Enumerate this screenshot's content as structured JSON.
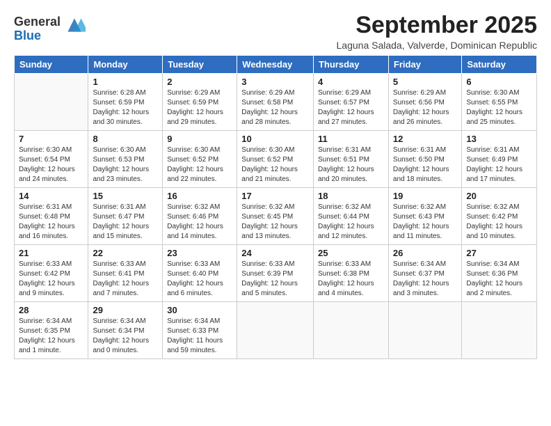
{
  "logo": {
    "general": "General",
    "blue": "Blue"
  },
  "title": "September 2025",
  "subtitle": "Laguna Salada, Valverde, Dominican Republic",
  "days": [
    "Sunday",
    "Monday",
    "Tuesday",
    "Wednesday",
    "Thursday",
    "Friday",
    "Saturday"
  ],
  "weeks": [
    [
      {
        "day": "",
        "content": ""
      },
      {
        "day": "1",
        "content": "Sunrise: 6:28 AM\nSunset: 6:59 PM\nDaylight: 12 hours\nand 30 minutes."
      },
      {
        "day": "2",
        "content": "Sunrise: 6:29 AM\nSunset: 6:59 PM\nDaylight: 12 hours\nand 29 minutes."
      },
      {
        "day": "3",
        "content": "Sunrise: 6:29 AM\nSunset: 6:58 PM\nDaylight: 12 hours\nand 28 minutes."
      },
      {
        "day": "4",
        "content": "Sunrise: 6:29 AM\nSunset: 6:57 PM\nDaylight: 12 hours\nand 27 minutes."
      },
      {
        "day": "5",
        "content": "Sunrise: 6:29 AM\nSunset: 6:56 PM\nDaylight: 12 hours\nand 26 minutes."
      },
      {
        "day": "6",
        "content": "Sunrise: 6:30 AM\nSunset: 6:55 PM\nDaylight: 12 hours\nand 25 minutes."
      }
    ],
    [
      {
        "day": "7",
        "content": "Sunrise: 6:30 AM\nSunset: 6:54 PM\nDaylight: 12 hours\nand 24 minutes."
      },
      {
        "day": "8",
        "content": "Sunrise: 6:30 AM\nSunset: 6:53 PM\nDaylight: 12 hours\nand 23 minutes."
      },
      {
        "day": "9",
        "content": "Sunrise: 6:30 AM\nSunset: 6:52 PM\nDaylight: 12 hours\nand 22 minutes."
      },
      {
        "day": "10",
        "content": "Sunrise: 6:30 AM\nSunset: 6:52 PM\nDaylight: 12 hours\nand 21 minutes."
      },
      {
        "day": "11",
        "content": "Sunrise: 6:31 AM\nSunset: 6:51 PM\nDaylight: 12 hours\nand 20 minutes."
      },
      {
        "day": "12",
        "content": "Sunrise: 6:31 AM\nSunset: 6:50 PM\nDaylight: 12 hours\nand 18 minutes."
      },
      {
        "day": "13",
        "content": "Sunrise: 6:31 AM\nSunset: 6:49 PM\nDaylight: 12 hours\nand 17 minutes."
      }
    ],
    [
      {
        "day": "14",
        "content": "Sunrise: 6:31 AM\nSunset: 6:48 PM\nDaylight: 12 hours\nand 16 minutes."
      },
      {
        "day": "15",
        "content": "Sunrise: 6:31 AM\nSunset: 6:47 PM\nDaylight: 12 hours\nand 15 minutes."
      },
      {
        "day": "16",
        "content": "Sunrise: 6:32 AM\nSunset: 6:46 PM\nDaylight: 12 hours\nand 14 minutes."
      },
      {
        "day": "17",
        "content": "Sunrise: 6:32 AM\nSunset: 6:45 PM\nDaylight: 12 hours\nand 13 minutes."
      },
      {
        "day": "18",
        "content": "Sunrise: 6:32 AM\nSunset: 6:44 PM\nDaylight: 12 hours\nand 12 minutes."
      },
      {
        "day": "19",
        "content": "Sunrise: 6:32 AM\nSunset: 6:43 PM\nDaylight: 12 hours\nand 11 minutes."
      },
      {
        "day": "20",
        "content": "Sunrise: 6:32 AM\nSunset: 6:42 PM\nDaylight: 12 hours\nand 10 minutes."
      }
    ],
    [
      {
        "day": "21",
        "content": "Sunrise: 6:33 AM\nSunset: 6:42 PM\nDaylight: 12 hours\nand 9 minutes."
      },
      {
        "day": "22",
        "content": "Sunrise: 6:33 AM\nSunset: 6:41 PM\nDaylight: 12 hours\nand 7 minutes."
      },
      {
        "day": "23",
        "content": "Sunrise: 6:33 AM\nSunset: 6:40 PM\nDaylight: 12 hours\nand 6 minutes."
      },
      {
        "day": "24",
        "content": "Sunrise: 6:33 AM\nSunset: 6:39 PM\nDaylight: 12 hours\nand 5 minutes."
      },
      {
        "day": "25",
        "content": "Sunrise: 6:33 AM\nSunset: 6:38 PM\nDaylight: 12 hours\nand 4 minutes."
      },
      {
        "day": "26",
        "content": "Sunrise: 6:34 AM\nSunset: 6:37 PM\nDaylight: 12 hours\nand 3 minutes."
      },
      {
        "day": "27",
        "content": "Sunrise: 6:34 AM\nSunset: 6:36 PM\nDaylight: 12 hours\nand 2 minutes."
      }
    ],
    [
      {
        "day": "28",
        "content": "Sunrise: 6:34 AM\nSunset: 6:35 PM\nDaylight: 12 hours\nand 1 minute."
      },
      {
        "day": "29",
        "content": "Sunrise: 6:34 AM\nSunset: 6:34 PM\nDaylight: 12 hours\nand 0 minutes."
      },
      {
        "day": "30",
        "content": "Sunrise: 6:34 AM\nSunset: 6:33 PM\nDaylight: 11 hours\nand 59 minutes."
      },
      {
        "day": "",
        "content": ""
      },
      {
        "day": "",
        "content": ""
      },
      {
        "day": "",
        "content": ""
      },
      {
        "day": "",
        "content": ""
      }
    ]
  ]
}
